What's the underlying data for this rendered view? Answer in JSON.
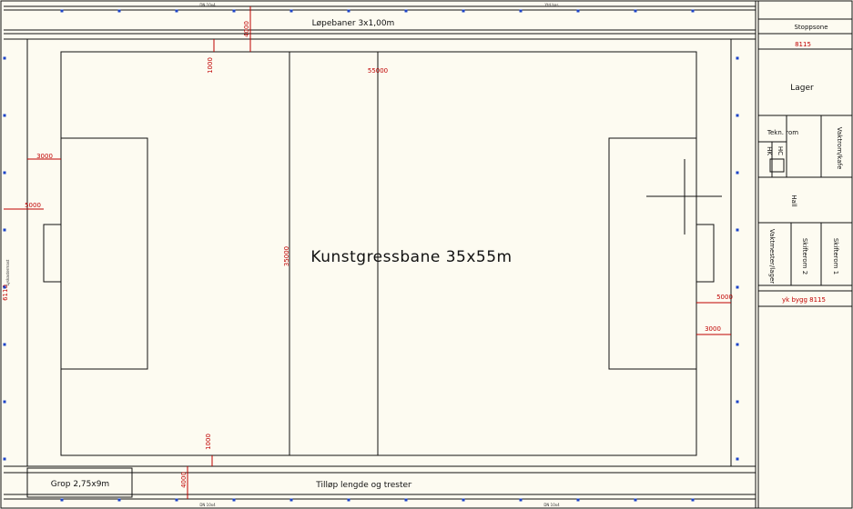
{
  "field": {
    "title": "Kunstgressbane 35x55m",
    "length_dim": "55000",
    "width_dim": "35000"
  },
  "track": {
    "top_label": "Løpebaner 3x1,00m",
    "bottom_label": "Tilløp lengde og trestег"
  },
  "pit": {
    "label": "Grop 2,75x9m"
  },
  "stop_zone": {
    "label": "Stoppsone",
    "dim": "8115"
  },
  "building": {
    "storage": "Lager",
    "tech_room": "Tekn. rom",
    "host_room": "Vaktrom/kafe",
    "hall": "Hall",
    "hk": "HK",
    "hc": "HC",
    "hc_wc": "HC WC",
    "caretaker": "Vaktmester/lager",
    "changing_2": "Skifterom 2",
    "changing_1": "Skifterom 1",
    "dim_label": "yk bygg 8115"
  },
  "dims": {
    "d4000_top": "4000",
    "d1000_top": "1000",
    "d3000_left": "3000",
    "d5000_left": "5000",
    "d5000_right": "5000",
    "d3000_right": "3000",
    "d1000_bottom": "1000",
    "d4000_bottom": "4000",
    "left_side": "6110"
  },
  "small_notes": {
    "top_a": "DN 10x4",
    "top_b": "Ytd bas",
    "bottom_a": "DN 10x4",
    "bottom_b": "DN 10x4",
    "side": "Lyskastermast"
  },
  "colors": {
    "background": "#fdfbf1",
    "lines": "#111111",
    "dimensions": "#c00000",
    "markers": "#1d44c8"
  }
}
